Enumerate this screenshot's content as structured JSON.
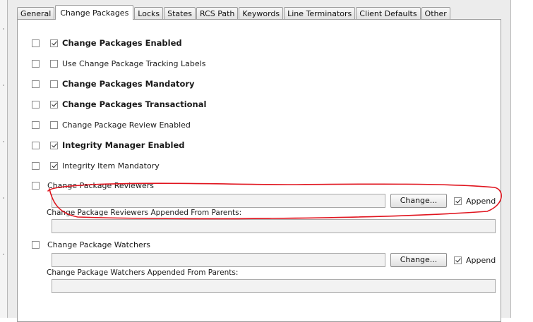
{
  "tabs": [
    "General",
    "Change Packages",
    "Locks",
    "States",
    "RCS Path",
    "Keywords",
    "Line Terminators",
    "Client Defaults",
    "Other"
  ],
  "active_tab_index": 1,
  "options": [
    {
      "label": "Change Packages Enabled",
      "checked": true,
      "bold": true,
      "override": false
    },
    {
      "label": "Use Change Package Tracking Labels",
      "checked": false,
      "bold": false,
      "override": false
    },
    {
      "label": "Change Packages Mandatory",
      "checked": false,
      "bold": true,
      "override": false
    },
    {
      "label": "Change Packages Transactional",
      "checked": true,
      "bold": true,
      "override": false
    },
    {
      "label": "Change Package Review Enabled",
      "checked": false,
      "bold": false,
      "override": false
    },
    {
      "label": "Integrity Manager Enabled",
      "checked": true,
      "bold": true,
      "override": false
    },
    {
      "label": "Integrity Item Mandatory",
      "checked": true,
      "bold": false,
      "override": false
    }
  ],
  "reviewers": {
    "label": "Change Package Reviewers",
    "value": "",
    "change_button": "Change...",
    "append_label": "Append",
    "append_checked": true,
    "appended_label": "Change Package Reviewers Appended From Parents:",
    "appended_value": ""
  },
  "watchers": {
    "label": "Change Package Watchers",
    "value": "",
    "change_button": "Change...",
    "append_label": "Append",
    "append_checked": true,
    "appended_label": "Change Package Watchers Appended From Parents:",
    "appended_value": ""
  },
  "colors": {
    "annotation": "#e0141e",
    "panel_bg": "#ffffff",
    "frame_bg": "#ececec"
  }
}
